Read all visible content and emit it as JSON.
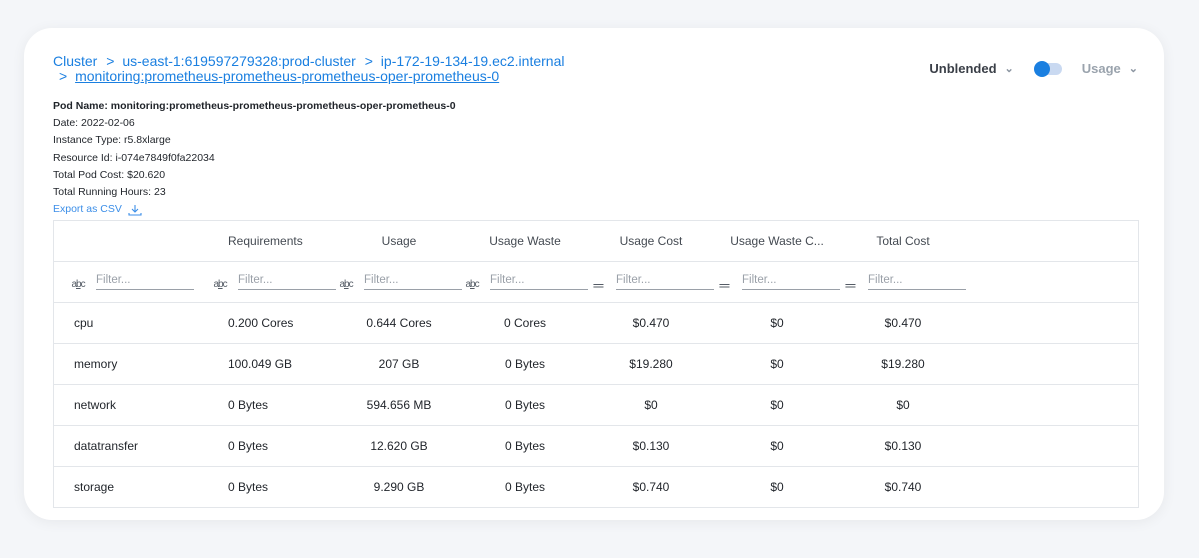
{
  "breadcrumb": {
    "root": "Cluster",
    "cluster": "us-east-1:619597279328:prod-cluster",
    "node": "ip-172-19-134-19.ec2.internal",
    "pod": "monitoring:prometheus-prometheus-prometheus-oper-prometheus-0",
    "separator": ">"
  },
  "controls": {
    "cost_type": "Unblended",
    "metric": "Usage",
    "toggle_on": true
  },
  "meta": {
    "pod_name_label": "Pod Name:",
    "pod_name": "monitoring:prometheus-prometheus-prometheus-oper-prometheus-0",
    "date_label": "Date:",
    "date": "2022-02-06",
    "instance_type_label": "Instance Type:",
    "instance_type": "r5.8xlarge",
    "resource_id_label": "Resource Id:",
    "resource_id": "i-074e7849f0fa22034",
    "total_pod_cost_label": "Total Pod Cost:",
    "total_pod_cost": "$20.620",
    "total_running_hours_label": "Total Running Hours:",
    "total_running_hours": "23",
    "export_label": "Export as CSV"
  },
  "table": {
    "headers": [
      "",
      "Requirements",
      "Usage",
      "Usage Waste",
      "Usage Cost",
      "Usage Waste C...",
      "Total Cost"
    ],
    "filter_placeholder": "Filter...",
    "rows": [
      [
        "cpu",
        "0.200 Cores",
        "0.644 Cores",
        "0 Cores",
        "$0.470",
        "$0",
        "$0.470"
      ],
      [
        "memory",
        "100.049 GB",
        "207 GB",
        "0 Bytes",
        "$19.280",
        "$0",
        "$19.280"
      ],
      [
        "network",
        "0 Bytes",
        "594.656 MB",
        "0 Bytes",
        "$0",
        "$0",
        "$0"
      ],
      [
        "datatransfer",
        "0 Bytes",
        "12.620 GB",
        "0 Bytes",
        "$0.130",
        "$0",
        "$0.130"
      ],
      [
        "storage",
        "0 Bytes",
        "9.290 GB",
        "0 Bytes",
        "$0.740",
        "$0",
        "$0.740"
      ]
    ]
  }
}
